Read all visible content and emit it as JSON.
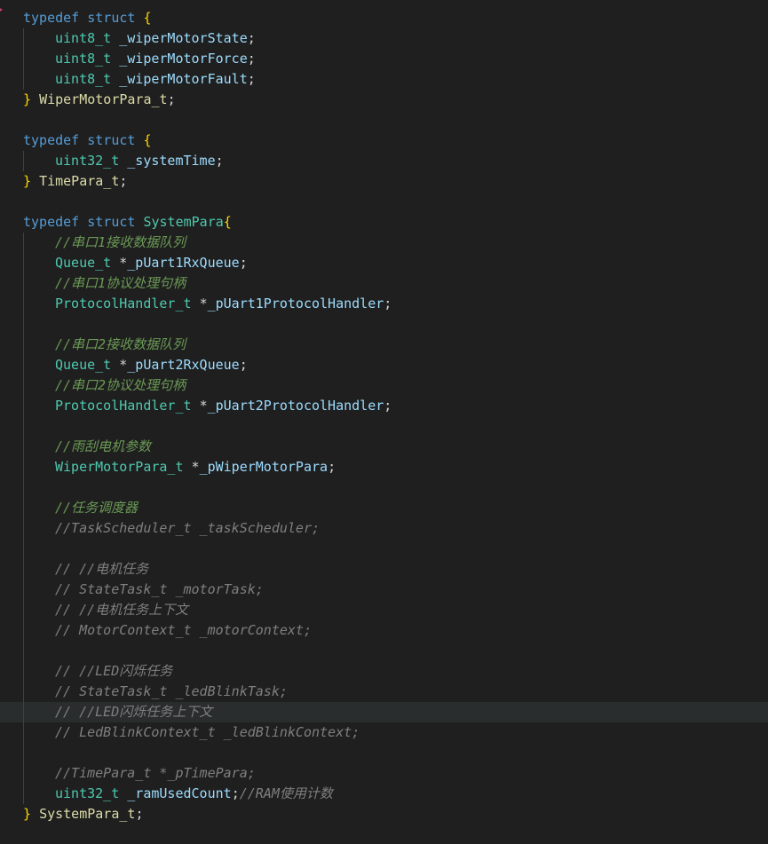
{
  "code": {
    "s1": {
      "kw1": "typedef",
      "kw2": "struct",
      "open": "{",
      "f1_type": "uint8_t",
      "f1_name": "_wiperMotorState",
      "f2_type": "uint8_t",
      "f2_name": "_wiperMotorForce",
      "f3_type": "uint8_t",
      "f3_name": "_wiperMotorFault",
      "close": "}",
      "name": "WiperMotorPara_t"
    },
    "s2": {
      "kw1": "typedef",
      "kw2": "struct",
      "open": "{",
      "f1_type": "uint32_t",
      "f1_name": "_systemTime",
      "close": "}",
      "name": "TimePara_t"
    },
    "s3": {
      "kw1": "typedef",
      "kw2": "struct",
      "tag": "SystemPara",
      "open": "{",
      "c1": "//串口1接收数据队列",
      "f1_type": "Queue_t",
      "f1_name": "_pUart1RxQueue",
      "c2": "//串口1协议处理句柄",
      "f2_type": "ProtocolHandler_t",
      "f2_name": "_pUart1ProtocolHandler",
      "c3": "//串口2接收数据队列",
      "f3_type": "Queue_t",
      "f3_name": "_pUart2RxQueue",
      "c4": "//串口2协议处理句柄",
      "f4_type": "ProtocolHandler_t",
      "f4_name": "_pUart2ProtocolHandler",
      "c5": "//雨刮电机参数",
      "f5_type": "WiperMotorPara_t",
      "f5_name": "_pWiperMotorPara",
      "c6": "//任务调度器",
      "c7": "//TaskScheduler_t _taskScheduler;",
      "c8": "// //电机任务",
      "c9": "// StateTask_t _motorTask;",
      "c10": "// //电机任务上下文",
      "c11": "// MotorContext_t _motorContext;",
      "c12": "// //LED闪烁任务",
      "c13": "// StateTask_t _ledBlinkTask;",
      "c14": "// //LED闪烁任务上下文",
      "c15": "// LedBlinkContext_t _ledBlinkContext;",
      "c16": "//TimePara_t *_pTimePara;",
      "f6_type": "uint32_t",
      "f6_name": "_ramUsedCount",
      "c17": "//RAM使用计数",
      "close": "}",
      "name": "SystemPara_t"
    },
    "ptr": "*",
    "semi": ";"
  },
  "colors": {
    "background": "#1f1f1f",
    "keyword": "#569cd6",
    "type": "#4ec9b0",
    "variable": "#9cdcfe",
    "typedef_name": "#dcdcaa",
    "bracket": "#ffd700",
    "comment": "#6a9955",
    "commented_code": "#7f7f7f",
    "current_line": "#2a2d2e"
  }
}
